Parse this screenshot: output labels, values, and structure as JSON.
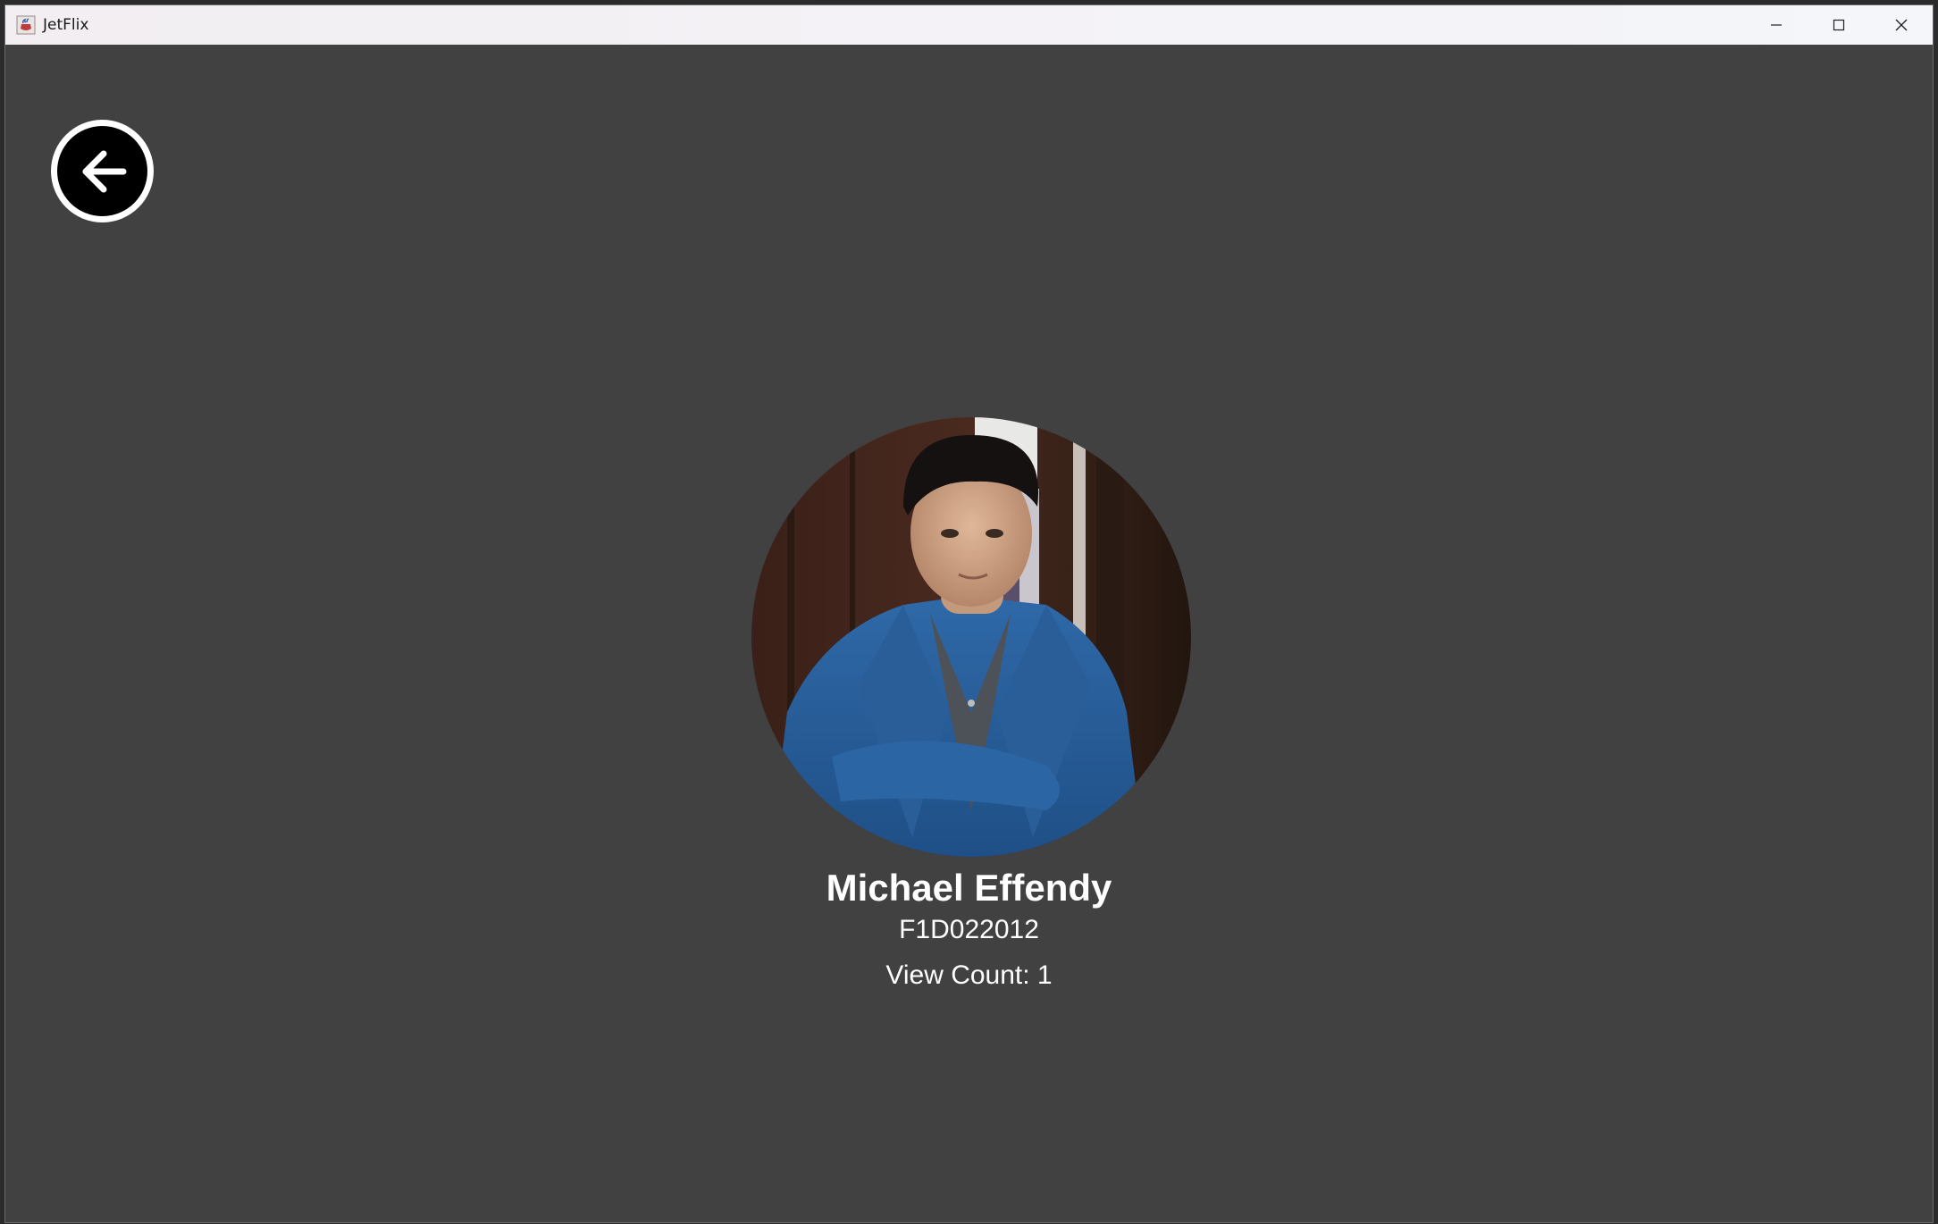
{
  "window": {
    "title": "JetFlix",
    "app_icon": "java-cup-icon",
    "controls": {
      "minimize": "minimize-icon",
      "maximize": "maximize-icon",
      "close": "close-icon"
    }
  },
  "nav": {
    "back_icon": "arrow-left-circle-icon"
  },
  "profile": {
    "name": "Michael Effendy",
    "student_id": "F1D022012",
    "view_count": "View Count: 1"
  },
  "colors": {
    "background": "#414141",
    "text": "#ffffff",
    "titlebar": "#f3f1f5"
  }
}
